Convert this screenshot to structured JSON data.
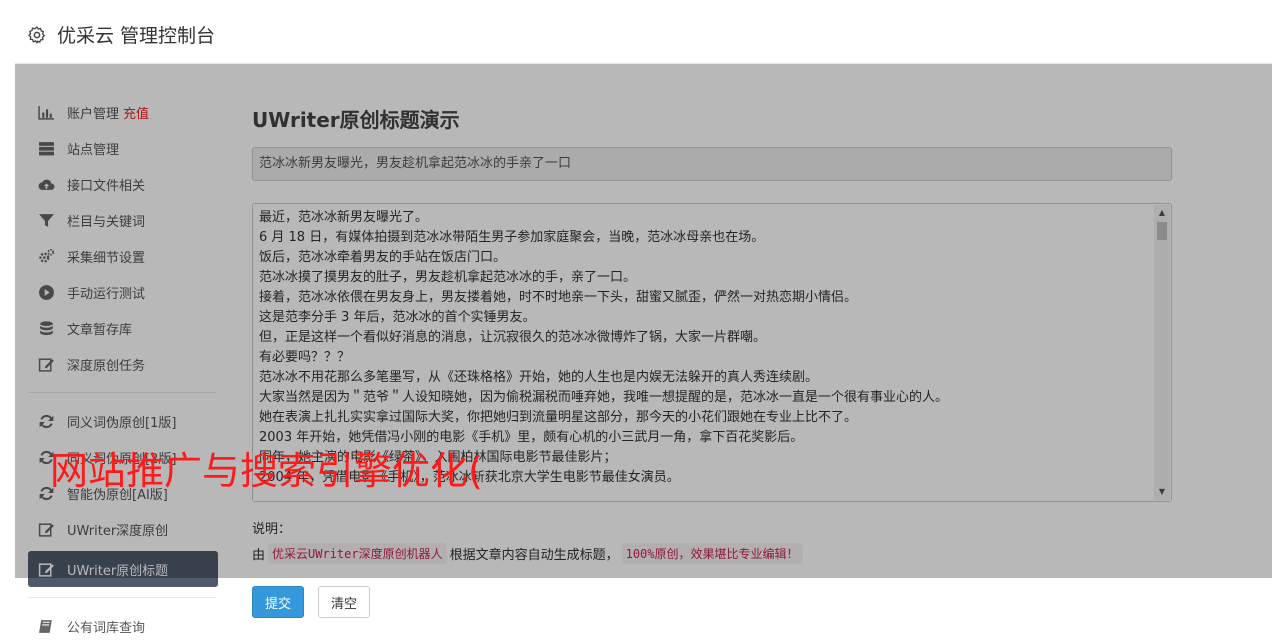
{
  "header": {
    "title": "优采云 管理控制台"
  },
  "sidebar": {
    "items": [
      {
        "label": "账户管理",
        "badge": "充值",
        "icon": "bar-chart-icon"
      },
      {
        "label": "站点管理",
        "icon": "server-icon"
      },
      {
        "label": "接口文件相关",
        "icon": "cloud-upload-icon"
      },
      {
        "label": "栏目与关键词",
        "icon": "filter-icon"
      },
      {
        "label": "采集细节设置",
        "icon": "cogs-icon"
      },
      {
        "label": "手动运行测试",
        "icon": "play-circle-icon"
      },
      {
        "label": "文章暂存库",
        "icon": "database-icon"
      },
      {
        "label": "深度原创任务",
        "icon": "edit-icon"
      },
      {
        "label": "同义词伪原创[1版]",
        "icon": "refresh-icon"
      },
      {
        "label": "同义词伪原创[2版]",
        "icon": "refresh-icon"
      },
      {
        "label": "智能伪原创[AI版]",
        "icon": "refresh-icon"
      },
      {
        "label": "UWriter深度原创",
        "icon": "edit-icon"
      },
      {
        "label": "UWriter原创标题",
        "icon": "edit-icon"
      },
      {
        "label": "公有词库查询",
        "icon": "book-icon"
      }
    ]
  },
  "main": {
    "page_title": "UWriter原创标题演示",
    "title_value": "范冰冰新男友曝光，男友趁机拿起范冰冰的手亲了一口",
    "article_lines": [
      "最近，范冰冰新男友曝光了。",
      "6 月 18 日，有媒体拍摄到范冰冰带陌生男子参加家庭聚会，当晚，范冰冰母亲也在场。",
      "饭后，范冰冰牵着男友的手站在饭店门口。",
      "范冰冰摸了摸男友的肚子，男友趁机拿起范冰冰的手，亲了一口。",
      "接着，范冰冰依偎在男友身上，男友搂着她，时不时地亲一下头，甜蜜又腻歪，俨然一对热恋期小情侣。",
      "这是范李分手 3 年后，范冰冰的首个实锤男友。",
      "但，正是这样一个看似好消息的消息，让沉寂很久的范冰冰微博炸了锅，大家一片群嘲。",
      "有必要吗？？？",
      "范冰冰不用花那么多笔墨写，从《还珠格格》开始，她的人生也是内娱无法躲开的真人秀连续剧。",
      "大家当然是因为＂范爷＂人设知晓她，因为偷税漏税而唾弃她，我唯一想提醒的是，范冰冰一直是一个很有事业心的人。",
      "她在表演上扎扎实实拿过国际大奖，你把她归到流量明星这部分，那今天的小花们跟她在专业上比不了。",
      "2003 年开始，她凭借冯小刚的电影《手机》里，颇有心机的小三武月一角，拿下百花奖影后。",
      "同年，她主演的电影《绿茶》，入围柏林国际电影节最佳影片；",
      "2004 年，凭借电影《手机》，范冰冰斩获北京大学生电影节最佳女演员。"
    ],
    "note_label": "说明：",
    "note_prefix": "由",
    "note_code1": "优采云UWriter深度原创机器人",
    "note_middle": "根据文章内容自动生成标题，",
    "note_code2": "100%原创，效果堪比专业编辑！",
    "submit_label": "提交",
    "clear_label": "清空"
  },
  "watermark": "网站推广与搜索引擎优化("
}
